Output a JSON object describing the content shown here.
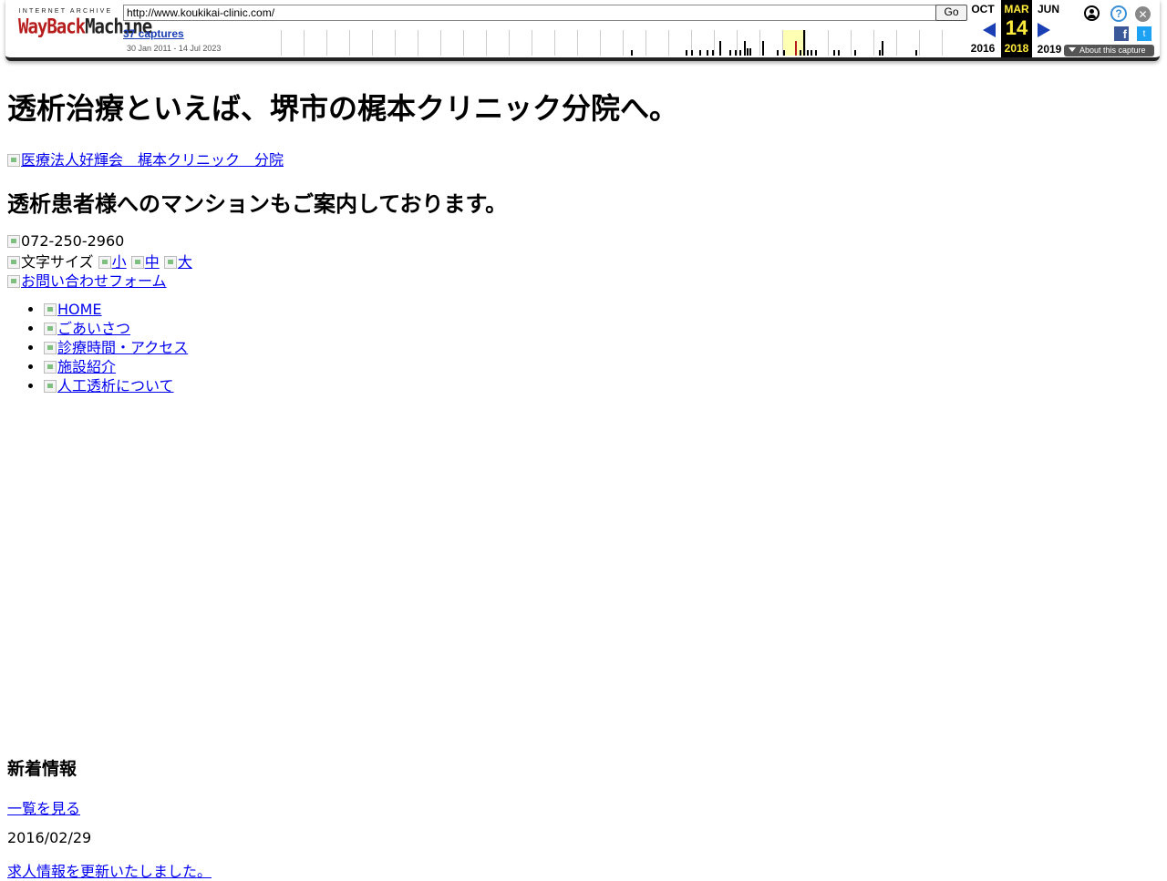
{
  "wayback": {
    "logo_top": "INTERNET ARCHIVE",
    "logo_way": "WayBack",
    "logo_machine": "Machine",
    "url": "http://www.koukikai-clinic.com/",
    "go_label": "Go",
    "captures_label": "37 captures",
    "capture_range": "30 Jan 2011 - 14 Jul 2023",
    "prev_month": "OCT",
    "prev_year": "2016",
    "current_month": "MAR",
    "current_day": "14",
    "current_year": "2018",
    "next_month": "JUN",
    "next_year": "2019",
    "about_label": "About this capture",
    "help_glyph": "?",
    "close_glyph": "✕",
    "fb_glyph": "f",
    "tw_glyph": "t"
  },
  "page": {
    "heading": "透析治療といえば、堺市の梶本クリニック分院へ。",
    "logo_alt": "医療法人好輝会　梶本クリニック　分院",
    "subheading": "透析患者様へのマンションもご案内しております。",
    "phone": "072-250-2960",
    "font_size_label": "文字サイズ",
    "font_sizes": [
      "小",
      "中",
      "大"
    ],
    "contact_link": "お問い合わせフォーム",
    "nav": [
      "HOME",
      "ごあいさつ",
      "診療時間・アクセス",
      "施設紹介",
      "人工透析について"
    ],
    "news_heading": "新着情報",
    "news_list_link": "一覧を見る",
    "news_date": "2016/02/29",
    "news_item": "求人情報を更新いたしました。"
  }
}
